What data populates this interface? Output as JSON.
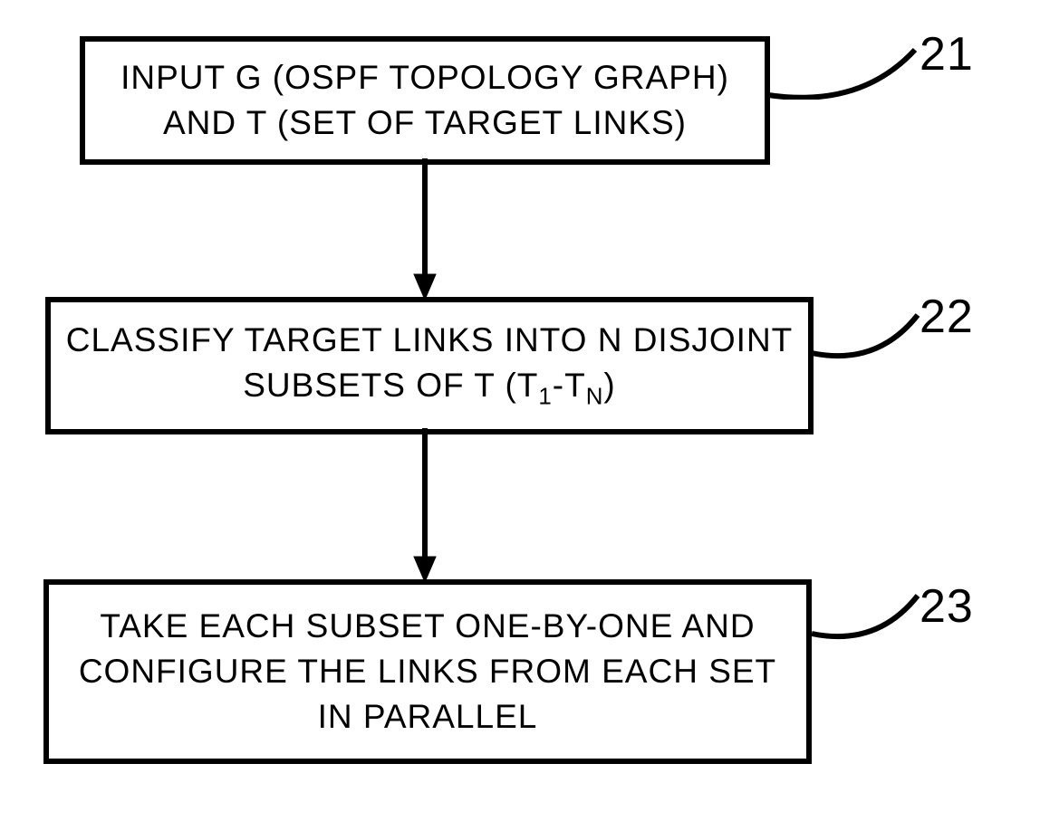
{
  "flowchart": {
    "boxes": [
      {
        "id": "21",
        "line1": "INPUT G (OSPF TOPOLOGY GRAPH)",
        "line2": "AND T (SET OF TARGET LINKS)"
      },
      {
        "id": "22",
        "line1": "CLASSIFY TARGET LINKS INTO N DISJOINT",
        "line2_prefix": "SUBSETS OF T (T",
        "line2_sub1": "1",
        "line2_mid": "-T",
        "line2_sub2": "N",
        "line2_suffix": ")"
      },
      {
        "id": "23",
        "line1": "TAKE EACH SUBSET ONE-BY-ONE AND",
        "line2": "CONFIGURE THE LINKS FROM EACH SET",
        "line3": "IN PARALLEL"
      }
    ],
    "labels": {
      "label_21": "21",
      "label_22": "22",
      "label_23": "23"
    }
  }
}
